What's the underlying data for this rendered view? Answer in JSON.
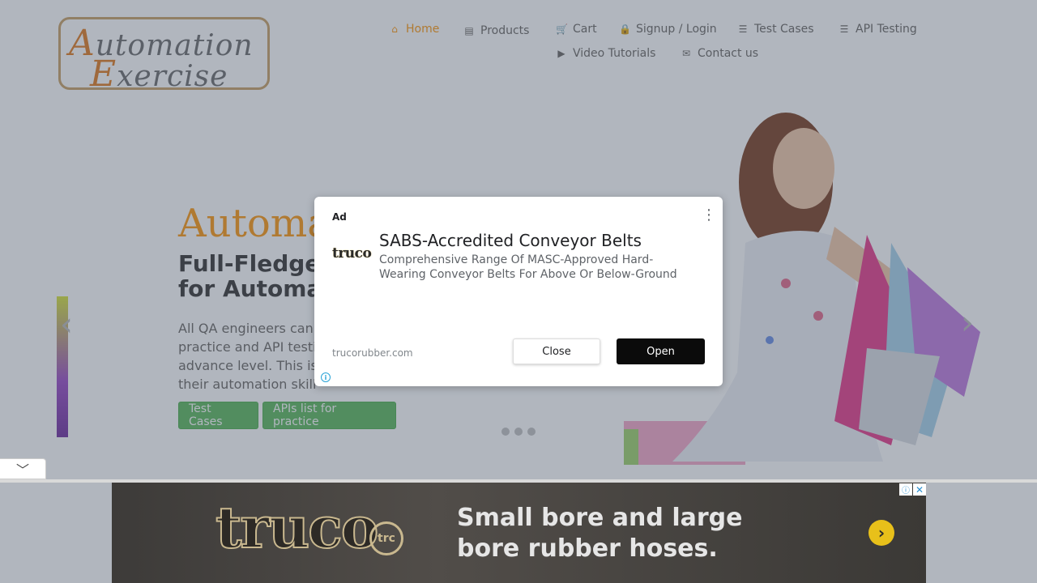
{
  "header": {
    "logo_line1_cap": "A",
    "logo_line1_rest": "utomation",
    "logo_line2_cap": "E",
    "logo_line2_rest": "xercise",
    "nav": [
      {
        "label": "Home",
        "icon": "home-icon"
      },
      {
        "label": "Products",
        "icon": "products-icon"
      },
      {
        "label": "Cart",
        "icon": "cart-icon"
      },
      {
        "label": "Signup / Login",
        "icon": "lock-icon"
      },
      {
        "label": "Test Cases",
        "icon": "list-icon"
      },
      {
        "label": "API Testing",
        "icon": "list-icon"
      },
      {
        "label": "Video Tutorials",
        "icon": "youtube-icon"
      },
      {
        "label": "Contact us",
        "icon": "envelope-icon"
      }
    ]
  },
  "hero": {
    "title": "Automa",
    "subtitle_line1": "Full-Fledge",
    "subtitle_line2": "for Automa",
    "text_line1": "All QA engineers can",
    "text_line2": "practice and API testi",
    "text_line3": "advance level. This is",
    "text_line4": "their automation skill",
    "btn_test_cases": "Test Cases",
    "btn_apis": "APIs list for practice"
  },
  "modal": {
    "ad_label": "Ad",
    "logo_text": "truco",
    "title": "SABS-Accredited Conveyor Belts",
    "description": "Comprehensive Range Of MASC-Approved Hard-Wearing Conveyor Belts For Above Or Below-Ground",
    "domain": "trucorubber.com",
    "close_label": "Close",
    "open_label": "Open"
  },
  "bottom_ad": {
    "brand": "truco",
    "badge": "trc",
    "headline1": "Small bore and large",
    "headline2": "bore rubber hoses."
  },
  "colors": {
    "accent": "#fe980f",
    "button_green": "#5cb85c",
    "overlay": "rgba(70,80,100,0.42)",
    "open_button": "#0b0b0b"
  }
}
